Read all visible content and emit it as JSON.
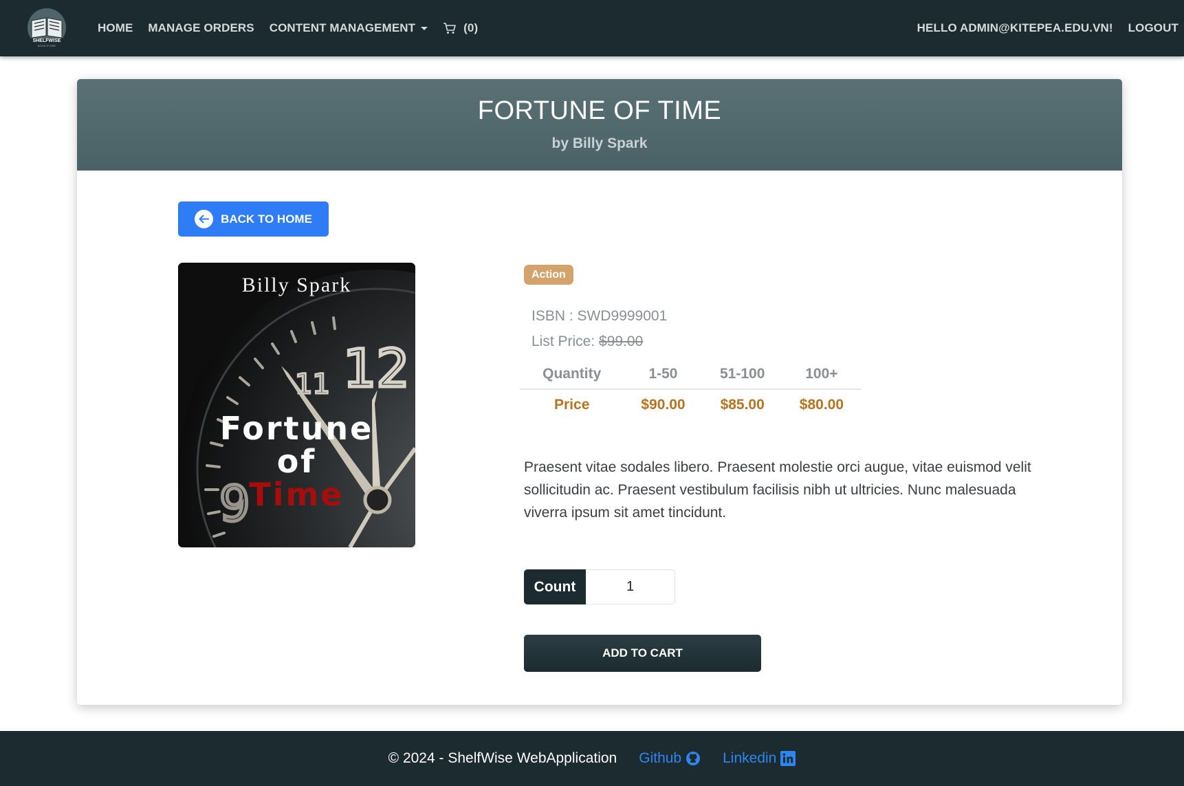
{
  "navbar": {
    "logo_text": "SHELFWISE",
    "logo_subtext": "BOOK STORE",
    "links": {
      "home": "HOME",
      "manage_orders": "MANAGE ORDERS",
      "content_management": "CONTENT MANAGEMENT",
      "cart_count": "(0)"
    },
    "greeting": "HELLO ADMIN@KITEPEA.EDU.VN!",
    "logout": "LOGOUT"
  },
  "book": {
    "title": "FORTUNE OF TIME",
    "author_line": "by Billy Spark",
    "category": "Action",
    "isbn_label": "ISBN : ",
    "isbn": "SWD9999001",
    "list_price_label": "List Price: ",
    "list_price": "$99.00",
    "cover": {
      "author": "Billy Spark",
      "title_line1": "Fortune",
      "title_line2": "of",
      "title_line3": "Time"
    },
    "description": "Praesent vitae sodales libero. Praesent molestie orci augue, vitae euismod velit sollicitudin ac. Praesent vestibulum facilisis nibh ut ultricies. Nunc malesuada viverra ipsum sit amet tincidunt."
  },
  "pricing": {
    "headers": [
      "Quantity",
      "1-50",
      "51-100",
      "100+"
    ],
    "row": [
      "Price",
      "$90.00",
      "$85.00",
      "$80.00"
    ]
  },
  "actions": {
    "back": "BACK TO HOME",
    "count_label": "Count",
    "count_value": "1",
    "add_to_cart": "ADD TO CART"
  },
  "footer": {
    "copyright": "© 2024 - ShelfWise WebApplication",
    "github": "Github",
    "linkedin": "Linkedin"
  },
  "colors": {
    "navbar_bg": "#1b2b30",
    "header_bg": "#56696e",
    "primary_blue": "#2e7cf6",
    "badge": "#d4a26b",
    "price_accent": "#b8731f",
    "link_blue": "#2f86f0"
  },
  "icons": [
    "book-logo-icon",
    "chevron-down-icon",
    "cart-icon",
    "arrow-left-circle-icon",
    "github-icon",
    "linkedin-icon"
  ]
}
